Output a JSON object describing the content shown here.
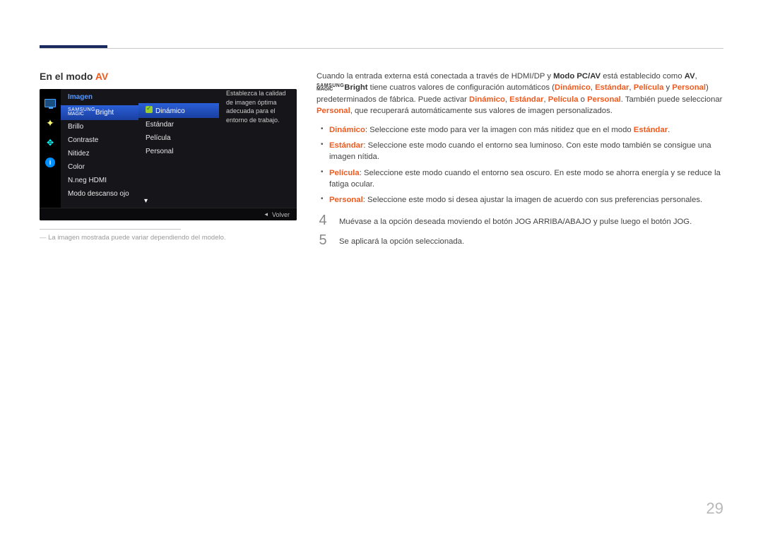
{
  "header": {},
  "section": {
    "title_prefix": "En el modo ",
    "title_mode": "AV"
  },
  "osd": {
    "category_header": "Imagen",
    "description": "Establezca la calidad de imagen óptima adecuada para el entorno de trabajo.",
    "back_label": "Volver",
    "back_arrow": "◂",
    "down_arrow": "▾",
    "magic_top": "SAMSUNG",
    "magic_bottom": "MAGIC",
    "magic_suffix": "Bright",
    "col1_items": [
      "Brillo",
      "Contraste",
      "Nitidez",
      "Color",
      "N.neg HDMI",
      "Modo descanso ojo"
    ],
    "col2_items": [
      "Dinámico",
      "Estándar",
      "Película",
      "Personal"
    ]
  },
  "disclaimer": "La imagen mostrada puede variar dependiendo del modelo.",
  "right": {
    "intro_1a": "Cuando la entrada externa está conectada a través de HDMI/DP y ",
    "intro_bold1": "Modo PC/AV",
    "intro_1b": " está establecido como ",
    "intro_bold2": "AV",
    "intro_1c": ", ",
    "intro_bright": "Bright",
    "intro_1d": " tiene cuatros valores de configuración automáticos (",
    "intro_d": "Dinámico",
    "sep1": ", ",
    "intro_e": "Estándar",
    "sep2": ", ",
    "intro_p": "Película",
    "intro_1e": " y ",
    "intro_pr": "Personal",
    "intro_1f": ") predeterminados de fábrica. Puede activar ",
    "intro_1g": " o ",
    "intro_1h": ". También puede seleccionar ",
    "intro_1i": ", que recuperará automáticamente sus valores de imagen personalizados.",
    "bullets": [
      {
        "bold": "Dinámico",
        "rest": ": Seleccione este modo para ver la imagen con más nitidez que en el modo ",
        "bold_end": "Estándar",
        "rest2": "."
      },
      {
        "bold": "Estándar",
        "rest": ": Seleccione este modo cuando el entorno sea luminoso. Con este modo también se consigue una imagen nítida."
      },
      {
        "bold": "Película",
        "rest": ": Seleccione este modo cuando el entorno sea oscuro. En este modo se ahorra energía y se reduce la fatiga ocular."
      },
      {
        "bold": "Personal",
        "rest": ": Seleccione este modo si desea ajustar la imagen de acuerdo con sus preferencias personales."
      }
    ],
    "step4_num": "4",
    "step4_text": "Muévase a la opción deseada moviendo el botón JOG ARRIBA/ABAJO y pulse luego el botón JOG.",
    "step5_num": "5",
    "step5_text": "Se aplicará la opción seleccionada."
  },
  "page_number": "29"
}
